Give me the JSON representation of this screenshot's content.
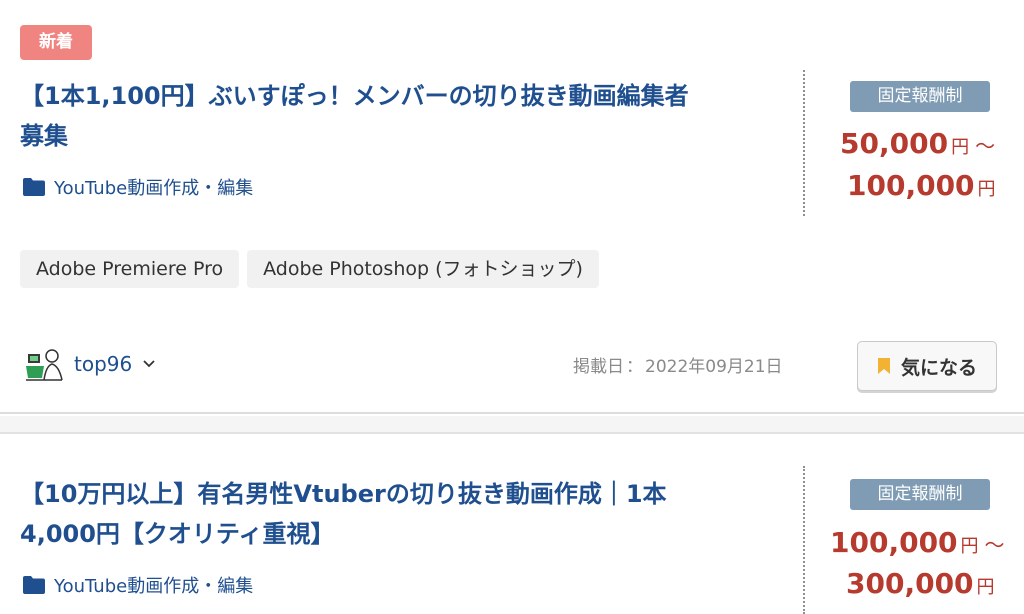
{
  "jobs": [
    {
      "badge": "新着",
      "title_line1": "【1本1,100円】ぶいすぽっ！メンバーの切り抜き動画編集者",
      "title_line2": "募集",
      "category": "YouTube動画作成・編集",
      "category_icon": "folder-icon",
      "price_type": "固定報酬制",
      "price_min": "50,000",
      "price_max": "100,000",
      "currency": "円",
      "range_sep": "〜",
      "tags": [
        "Adobe Premiere Pro",
        "Adobe Photoshop (フォトショップ)"
      ],
      "client_name": "top96",
      "posted_label": "掲載日",
      "posted_sep": "：",
      "posted_date": "2022年09月21日",
      "favorite_label": "気になる"
    },
    {
      "title_line1": "【10万円以上】有名男性Vtuberの切り抜き動画作成｜1本",
      "title_line2": "4,000円【クオリティ重視】",
      "category": "YouTube動画作成・編集",
      "category_icon": "folder-icon",
      "price_type": "固定報酬制",
      "price_min": "100,000",
      "price_max": "300,000",
      "currency": "円",
      "range_sep": "〜"
    }
  ],
  "colors": {
    "link": "#1f4f8f",
    "price": "#b63a2e",
    "new_badge": "#ef8480",
    "price_type_badge": "#7f9cb4",
    "bookmark": "#f2b233"
  }
}
